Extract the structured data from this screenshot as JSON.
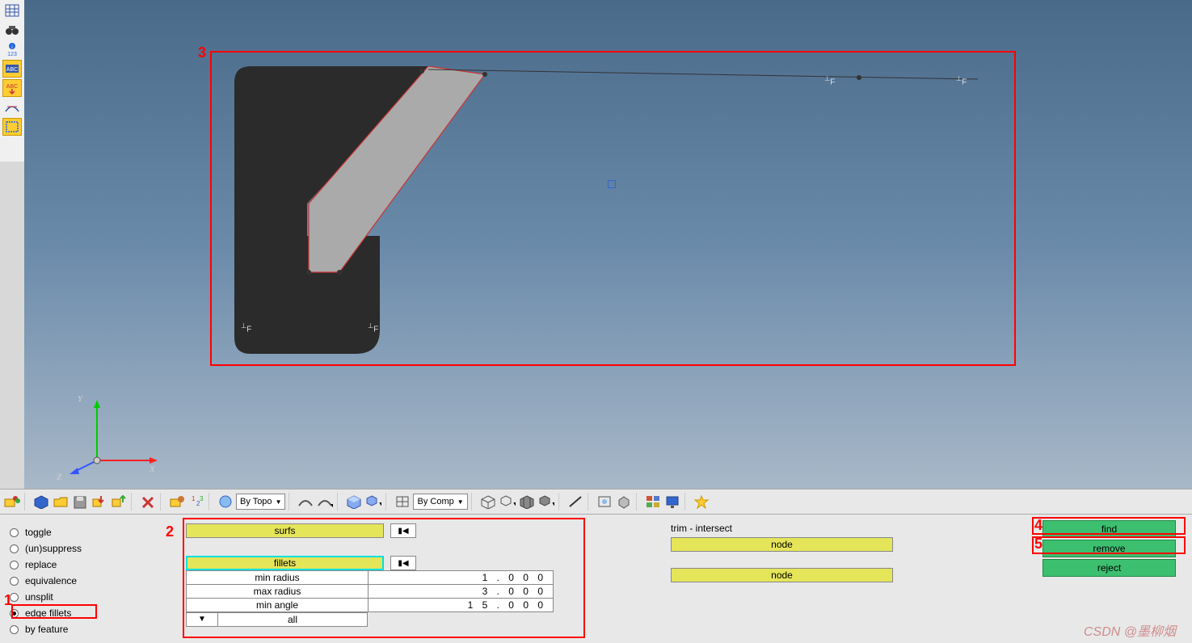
{
  "left_toolbar": {
    "items": [
      "grid",
      "binoculars",
      "info-123",
      "abc-bg",
      "abc-arrow",
      "tangent",
      "frame-select"
    ]
  },
  "viewport": {
    "annotation_3": "3",
    "axis": {
      "x": "X",
      "y": "Y",
      "z": "Z"
    },
    "fixed_markers": [
      "F",
      "F",
      "F",
      "F"
    ],
    "origin_marker": true
  },
  "main_toolbar": {
    "combo1": "By Topo",
    "combo2": "By Comp"
  },
  "radio_options": [
    {
      "label": "toggle",
      "selected": false
    },
    {
      "label": "(un)suppress",
      "selected": false
    },
    {
      "label": "replace",
      "selected": false
    },
    {
      "label": "equivalence",
      "selected": false
    },
    {
      "label": "unsplit",
      "selected": false
    },
    {
      "label": "edge fillets",
      "selected": true
    },
    {
      "label": "by feature",
      "selected": false
    }
  ],
  "middle": {
    "picker1": "surfs",
    "picker2": "fillets",
    "params": [
      {
        "label": "min radius",
        "value": "1 . 0 0 0"
      },
      {
        "label": "max radius",
        "value": "3 . 0 0 0"
      },
      {
        "label": "min angle",
        "value": "1 5 . 0 0 0"
      }
    ],
    "all_label": "all"
  },
  "right": {
    "trim_label": "trim - intersect",
    "node_label": "node"
  },
  "actions": {
    "find": "find",
    "remove": "remove",
    "reject": "reject"
  },
  "annotations": {
    "a1": "1",
    "a2": "2",
    "a4": "4",
    "a5": "5"
  },
  "watermark": "CSDN @墨柳烟"
}
